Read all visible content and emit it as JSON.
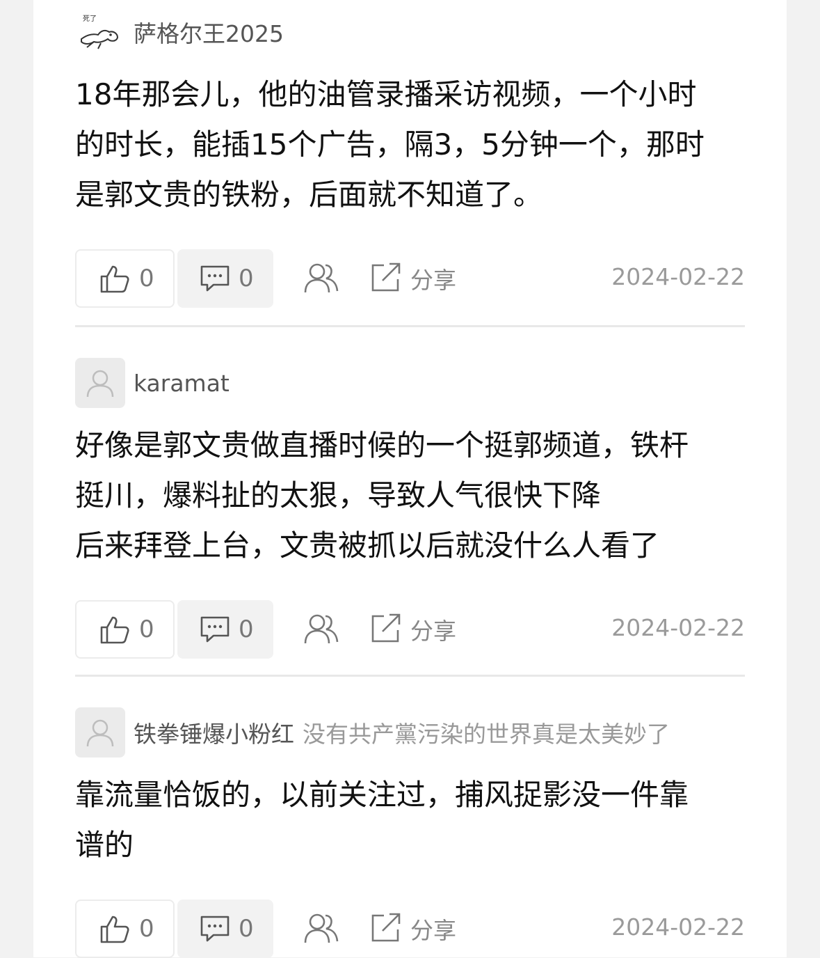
{
  "comments": [
    {
      "author": "萨格尔王2025",
      "signature": "",
      "avatar": "custom-drawn-avatar",
      "lines": [
        "18年那会儿，他的油管录播采访视频，一个小时",
        "的时长，能插15个广告，隔3，5分钟一个，那时",
        "是郭文贵的铁粉，后面就不知道了。"
      ],
      "likes": "0",
      "replies": "0",
      "share_label": "分享",
      "date": "2024-02-22"
    },
    {
      "author": "karamat",
      "signature": "",
      "avatar": "default-user-avatar",
      "lines": [
        "好像是郭文贵做直播时候的一个挺郭频道，铁杆",
        "挺川，爆料扯的太狠，导致人气很快下降",
        "后来拜登上台，文贵被抓以后就没什么人看了"
      ],
      "likes": "0",
      "replies": "0",
      "share_label": "分享",
      "date": "2024-02-22"
    },
    {
      "author": "铁拳锤爆小粉红",
      "signature": "没有共产黨污染的世界真是太美妙了",
      "avatar": "default-user-avatar",
      "lines": [
        "靠流量恰饭的，以前关注过，捕风捉影没一件靠",
        "谱的"
      ],
      "likes": "0",
      "replies": "0",
      "share_label": "分享",
      "date": "2024-02-22"
    }
  ],
  "colors": {
    "background": "#f2f2f2",
    "card": "#ffffff",
    "text": "#111111",
    "muted": "#999999"
  }
}
